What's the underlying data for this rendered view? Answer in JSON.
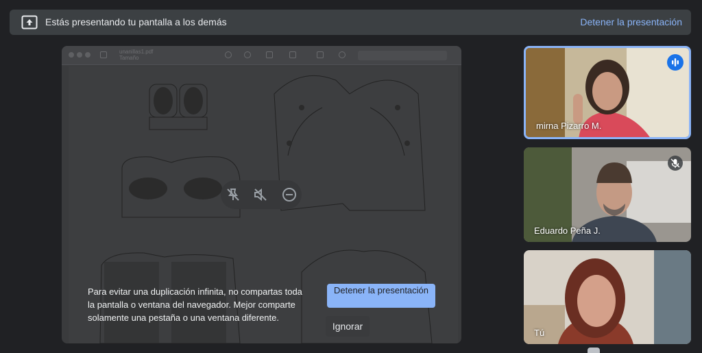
{
  "banner": {
    "message": "Estás presentando tu pantalla a los demás",
    "stop_label": "Detener la presentación"
  },
  "shared_screen": {
    "file_name": "unanillas1.pdf",
    "file_subtitle": "Tamaño"
  },
  "warning": {
    "text": "Para evitar una duplicación infinita, no compartas toda la pantalla o ventana del navegador. Mejor comparte solamente una pestaña o una ventana diferente.",
    "stop_label": "Detener la presentación",
    "ignore_label": "Ignorar"
  },
  "participants": [
    {
      "name": "mirna Pizarro M.",
      "state": "speaking"
    },
    {
      "name": "Eduardo Peña J.",
      "state": "muted"
    },
    {
      "name": "Tú",
      "state": "self"
    }
  ],
  "colors": {
    "accent": "#8ab4f8",
    "speaking": "#1a73e8",
    "background": "#202124",
    "banner": "#3c4043"
  }
}
